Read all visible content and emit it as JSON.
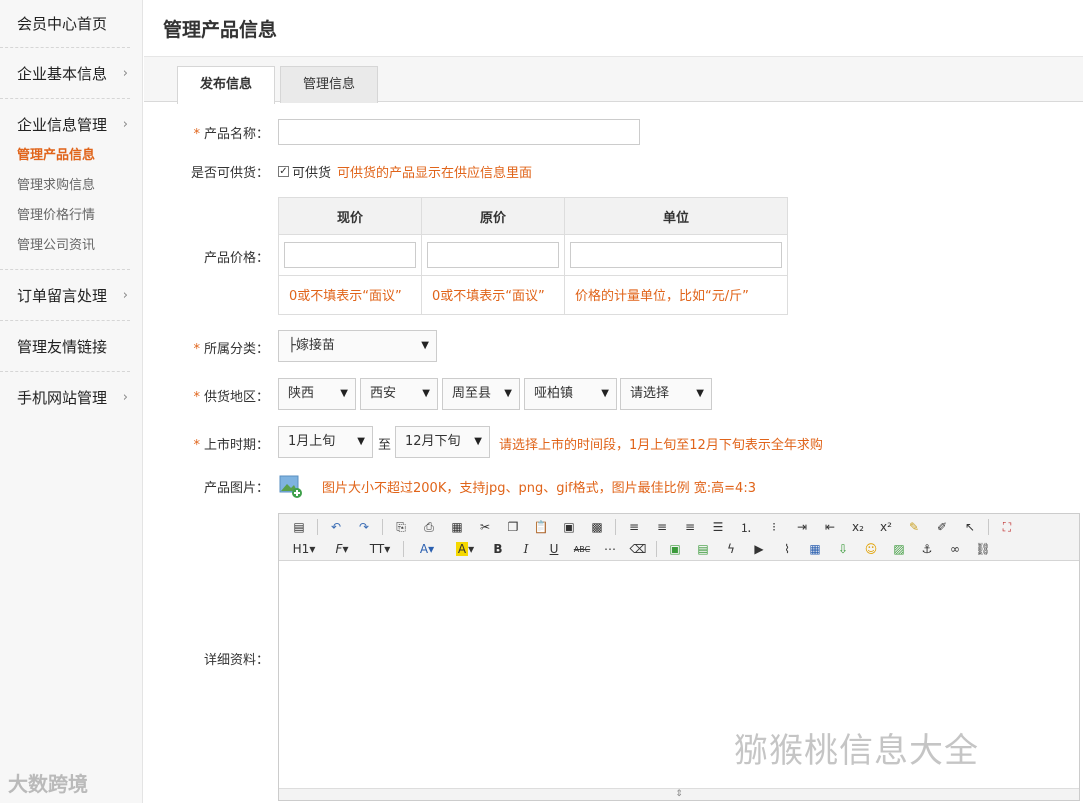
{
  "sidebar": {
    "home": "会员中心首页",
    "basic": "企业基本信息",
    "info_mgmt": "企业信息管理",
    "sub_items": [
      "管理产品信息",
      "管理求购信息",
      "管理价格行情",
      "管理公司资讯"
    ],
    "orders": "订单留言处理",
    "links": "管理友情链接",
    "mobile": "手机网站管理"
  },
  "page_title": "管理产品信息",
  "tabs": [
    "发布信息",
    "管理信息"
  ],
  "form": {
    "name_label": "产品名称：",
    "supply_label": "是否可供货：",
    "supply_checkbox": "可供货",
    "supply_hint": "可供货的产品显示在供应信息里面",
    "price_label": "产品价格：",
    "price_headers": [
      "现价",
      "原价",
      "单位"
    ],
    "price_hints": [
      "0或不填表示“面议”",
      "0或不填表示“面议”",
      "价格的计量单位，比如“元/斤”"
    ],
    "category_label": "所属分类：",
    "category_value": "├嫁接苗",
    "region_label": "供货地区：",
    "region_values": [
      "陕西",
      "西安",
      "周至县",
      "哑柏镇",
      "请选择"
    ],
    "market_label": "上市时期：",
    "market_from": "1月上旬",
    "market_to_sep": "至",
    "market_to": "12月下旬",
    "market_hint": "请选择上市的时间段，1月上旬至12月下旬表示全年求购",
    "image_label": "产品图片：",
    "image_hint": "图片大小不超过200K，支持jpg、png、gif格式，图片最佳比例 宽:高=4:3",
    "detail_label": "详细资料："
  },
  "editor": {
    "row2_labels": [
      "H1",
      "F",
      "TT",
      "A",
      "A",
      "B",
      "I",
      "U",
      "ABC"
    ]
  },
  "watermarks": {
    "right": "猕猴桃信息大全",
    "left": "大数跨境"
  },
  "colors": {
    "accent": "#e0641a"
  }
}
